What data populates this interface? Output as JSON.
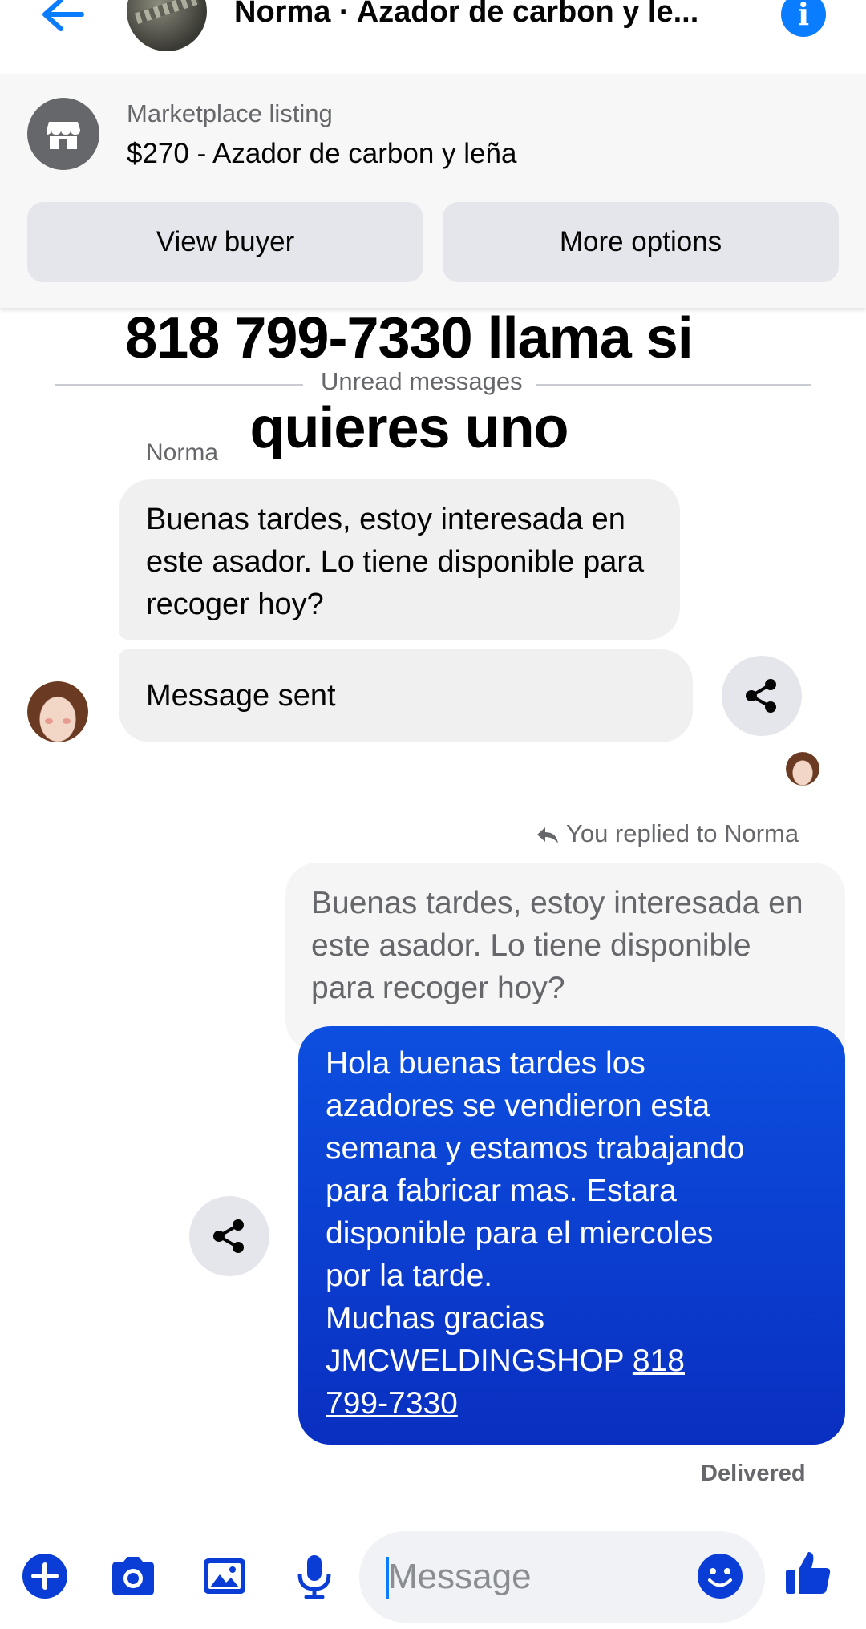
{
  "header": {
    "title": "Norma · Azador de carbon y le...",
    "back_icon": "arrow-left-icon",
    "info_icon": "info-icon"
  },
  "listing": {
    "label": "Marketplace listing",
    "title": "$270 - Azador de carbon y leña",
    "icon": "storefront-icon",
    "view_buyer_label": "View buyer",
    "more_options_label": "More options"
  },
  "overlay_caption": {
    "line1": "818 799-7330 llama si",
    "line2": "quieres uno"
  },
  "divider": {
    "label": "Unread messages"
  },
  "conversation": {
    "incoming_sender": "Norma",
    "incoming_message": "Buenas tardes, estoy interesada en este asador. Lo tiene disponible para recoger hoy?",
    "incoming_system": "Message sent",
    "replied_label": "You replied to Norma",
    "quoted_message": "Buenas tardes, estoy interesada en este asador. Lo tiene disponible para recoger hoy?",
    "outgoing_lines": [
      "Hola buenas tardes los",
      "azadores se vendieron esta",
      "semana y estamos trabajando",
      "para fabricar mas. Estara",
      "disponible para el miercoles",
      "por la tarde.",
      "Muchas gracias"
    ],
    "outgoing_signature": "JMCWELDINGSHOP",
    "outgoing_phone_part1": "818",
    "outgoing_phone_part2": "799-7330",
    "status": "Delivered"
  },
  "composer": {
    "placeholder": "Message",
    "icons": [
      "plus-icon",
      "camera-icon",
      "gallery-icon",
      "microphone-icon",
      "emoji-icon",
      "thumbs-up-icon"
    ]
  },
  "colors": {
    "accent": "#0a7cff",
    "outgoing_bubble": "#0b3fd0",
    "incoming_bubble": "#f0f0f0"
  }
}
